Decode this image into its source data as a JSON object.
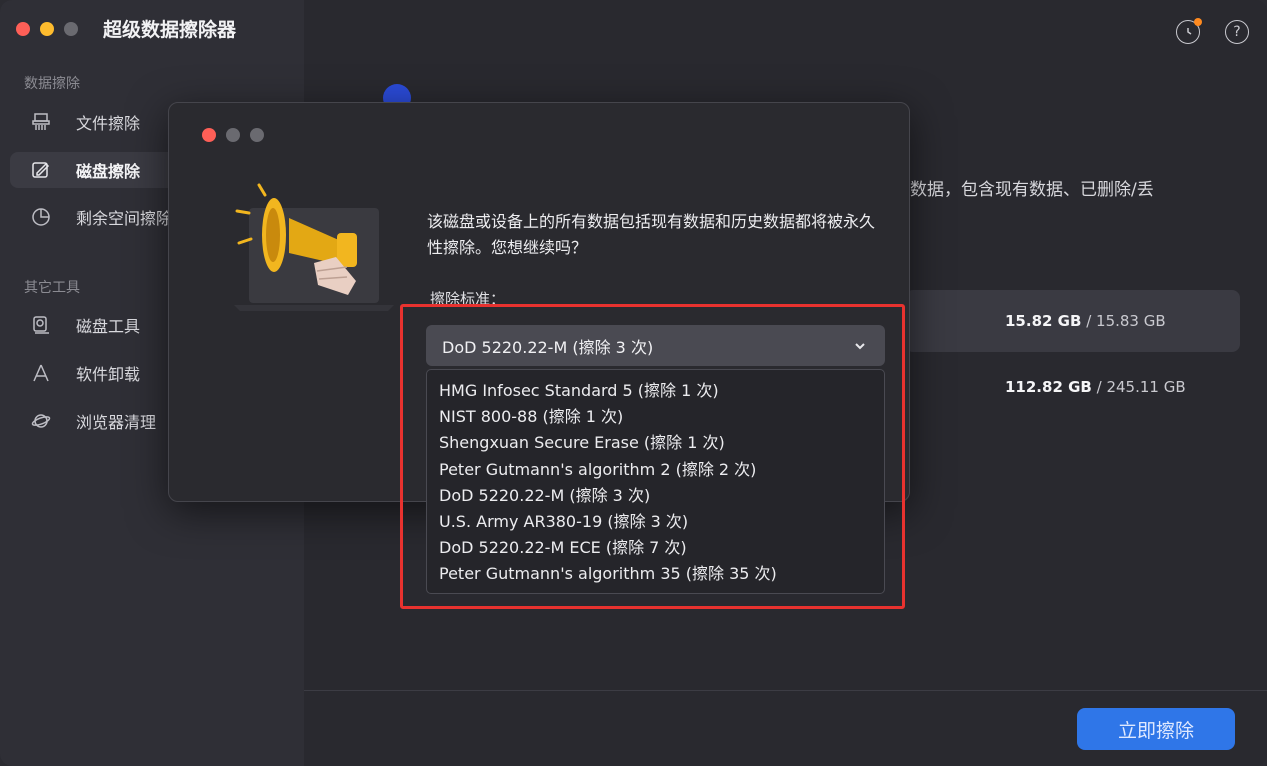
{
  "app": {
    "title": "超级数据擦除器"
  },
  "sidebar": {
    "section1": "数据擦除",
    "section2": "其它工具",
    "items": [
      {
        "label": "文件擦除",
        "icon": "shredder-icon"
      },
      {
        "label": "磁盘擦除",
        "icon": "disk-erase-icon",
        "active": true
      },
      {
        "label": "剩余空间擦除",
        "icon": "pie-chart-icon"
      },
      {
        "label": "磁盘工具",
        "icon": "disk-tool-icon"
      },
      {
        "label": "软件卸载",
        "icon": "uninstall-icon"
      },
      {
        "label": "浏览器清理",
        "icon": "browser-clean-icon"
      }
    ]
  },
  "main": {
    "description_fragment": "数据，包含现有数据、已删除/丢",
    "disks": [
      {
        "used": "15.82 GB",
        "total": "/ 15.83 GB"
      },
      {
        "used": "112.82 GB",
        "total": "/ 245.11 GB"
      }
    ],
    "erase_button": "立即擦除"
  },
  "dialog": {
    "message": "该磁盘或设备上的所有数据包括现有数据和历史数据都将被永久性擦除。您想继续吗？",
    "standard_label": "擦除标准：",
    "selected": "DoD 5220.22-M (擦除 3 次)",
    "options": [
      "HMG Infosec Standard 5 (擦除 1 次)",
      "NIST 800-88 (擦除 1 次)",
      "Shengxuan Secure Erase (擦除 1 次)",
      "Peter Gutmann's algorithm 2 (擦除 2 次)",
      "DoD 5220.22-M (擦除 3 次)",
      "U.S. Army AR380-19 (擦除 3 次)",
      "DoD 5220.22-M ECE (擦除 7 次)",
      "Peter Gutmann's algorithm 35 (擦除 35 次)"
    ]
  },
  "colors": {
    "accent": "#2f76e8",
    "highlight": "#e8322f",
    "megaphone": "#f2b61f"
  }
}
